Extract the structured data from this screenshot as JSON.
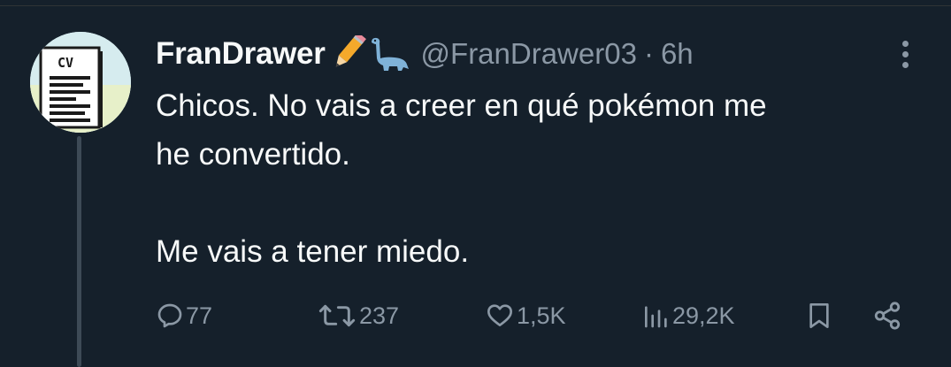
{
  "tweet": {
    "display_name": "FranDrawer",
    "name_emojis": [
      "pencil-emoji",
      "sauropod-emoji"
    ],
    "handle": "@FranDrawer03",
    "separator": "·",
    "time": "6h",
    "avatar": {
      "badge_text": "CV"
    },
    "text_lines": [
      "Chicos. No vais a creer en qué pokémon me",
      "he convertido.",
      "Me vais a tener miedo."
    ]
  },
  "actions": {
    "replies": "77",
    "retweets": "237",
    "likes": "1,5K",
    "views": "29,2K"
  },
  "colors": {
    "background": "#15202b",
    "text": "#f7f9f9",
    "secondary": "#8b98a5",
    "thread_line": "#3d4a56"
  },
  "icons": [
    "reply-icon",
    "retweet-icon",
    "like-icon",
    "views-icon",
    "bookmark-icon",
    "share-icon",
    "more-icon"
  ]
}
